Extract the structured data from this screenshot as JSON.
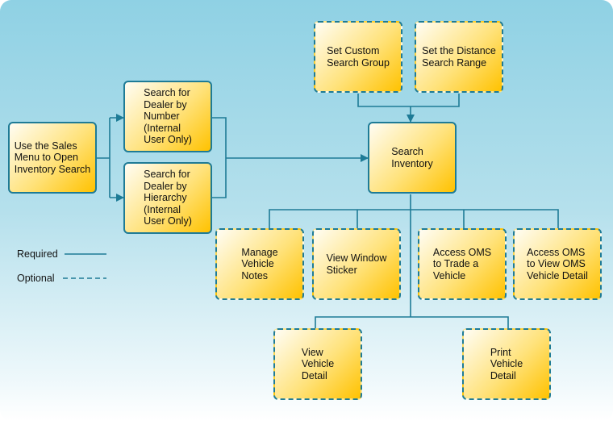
{
  "colors": {
    "line": "#1e7b96",
    "box_fill_start": "#fffdf4",
    "box_fill_end": "#ffc200",
    "background_top": "#8fd1e4"
  },
  "boxes": [
    {
      "id": "use-sales-menu",
      "style": "required",
      "lines": [
        "Use the Sales",
        "Menu to Open",
        "Inventory Search"
      ]
    },
    {
      "id": "search-dealer-number",
      "style": "required",
      "lines": [
        "Search for",
        "Dealer by",
        "Number",
        "(Internal",
        "User Only)"
      ]
    },
    {
      "id": "search-dealer-hierarchy",
      "style": "required",
      "lines": [
        "Search for",
        "Dealer by",
        "Hierarchy",
        "(Internal",
        "User Only)"
      ]
    },
    {
      "id": "set-custom-search-group",
      "style": "optional",
      "lines": [
        "Set Custom",
        "Search Group"
      ]
    },
    {
      "id": "set-distance-search-range",
      "style": "optional",
      "lines": [
        "Set the Distance",
        "Search Range"
      ]
    },
    {
      "id": "search-inventory",
      "style": "required",
      "lines": [
        "Search",
        "Inventory"
      ]
    },
    {
      "id": "manage-vehicle-notes",
      "style": "optional",
      "lines": [
        "Manage",
        "Vehicle",
        "Notes"
      ]
    },
    {
      "id": "view-window-sticker",
      "style": "optional",
      "lines": [
        "View Window",
        "Sticker"
      ]
    },
    {
      "id": "access-oms-trade",
      "style": "optional",
      "lines": [
        "Access OMS",
        "to Trade a",
        "Vehicle"
      ]
    },
    {
      "id": "access-oms-view-detail",
      "style": "optional",
      "lines": [
        "Access OMS",
        "to View OMS",
        "Vehicle Detail"
      ]
    },
    {
      "id": "view-vehicle-detail",
      "style": "optional",
      "lines": [
        "View",
        "Vehicle",
        "Detail"
      ]
    },
    {
      "id": "print-vehicle-detail",
      "style": "optional",
      "lines": [
        "Print",
        "Vehicle",
        "Detail"
      ]
    }
  ],
  "legend": {
    "required": "Required",
    "optional": "Optional"
  }
}
